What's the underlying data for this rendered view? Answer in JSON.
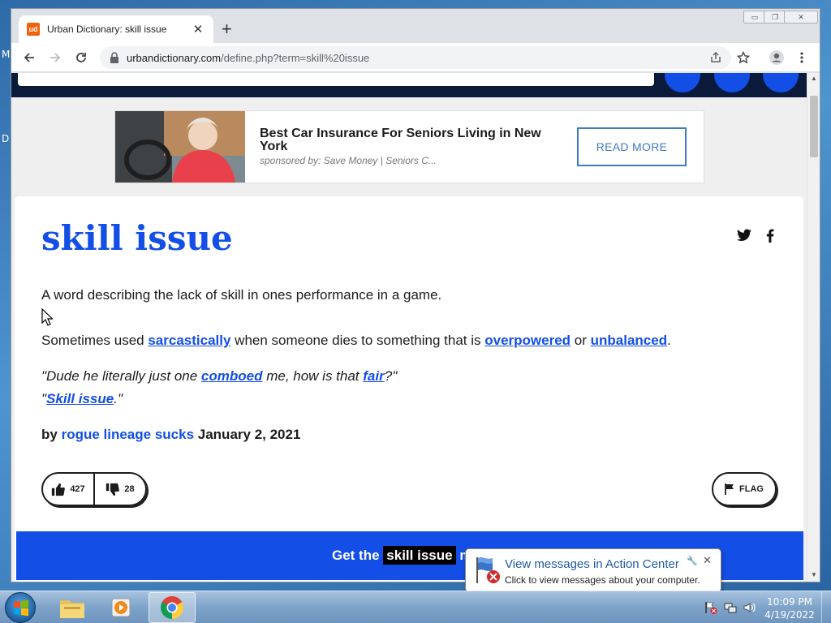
{
  "desktop": {
    "fragments": [
      "M",
      "D"
    ]
  },
  "browser": {
    "tab": {
      "favicon": "ud",
      "title": "Urban Dictionary: skill issue",
      "close": "✕"
    },
    "new_tab": "+",
    "window_controls": [
      "▭",
      "❐",
      "✕"
    ],
    "url": {
      "host": "urbandictionary.com",
      "path": "/define.php?term=skill%20issue"
    }
  },
  "ad": {
    "title": "Best Car Insurance For Seniors Living in New York",
    "sponsor": "sponsored by: Save Money | Seniors C...",
    "button": "READ MORE"
  },
  "definition": {
    "word": "skill issue",
    "meaning": "A word describing the lack of skill in ones performance in a game.",
    "extra": {
      "before": "Sometimes used ",
      "link1": "sarcastically",
      "middle": " when someone dies to something that is ",
      "link2": "overpowered",
      "or": " or ",
      "link3": "unbalanced",
      "end": "."
    },
    "example_line1": {
      "a": "\"Dude he literally just one ",
      "link1": "comboed",
      "b": " me, how is that ",
      "link2": "fair",
      "c": "?\""
    },
    "example_line2": {
      "a": "\"",
      "link": "Skill issue",
      "b": ".\""
    },
    "by_label": "by",
    "author": "rogue lineage sucks",
    "date": "January 2, 2021",
    "upvotes": "427",
    "downvotes": "28",
    "flag_label": "FLAG"
  },
  "banner": {
    "prefix": "Get the",
    "highlight": "skill issue",
    "suffix": "m"
  },
  "notification": {
    "title": "View messages in Action Center",
    "subtitle": "Click to view messages about your computer.",
    "close": "✕"
  },
  "taskbar": {
    "clock_time": "10:09 PM",
    "clock_date": "4/19/2022"
  },
  "colors": {
    "ud_blue": "#134fe6",
    "ud_navy": "#0b1a3a",
    "link_blue": "#1e5aa8"
  }
}
